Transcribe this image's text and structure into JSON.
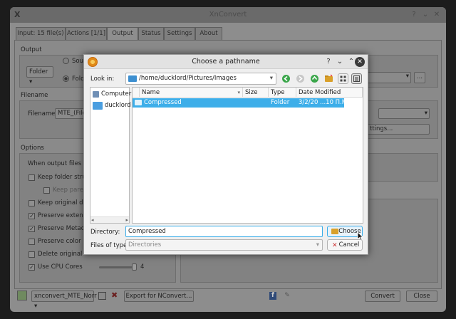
{
  "main_window": {
    "title": "XnConvert",
    "tabs": [
      {
        "label": "Input: 15 file(s)"
      },
      {
        "label": "Actions [1/1]"
      },
      {
        "label": "Output"
      },
      {
        "label": "Status"
      },
      {
        "label": "Settings"
      },
      {
        "label": "About"
      }
    ],
    "output": {
      "section": "Output",
      "dest_combo": "Folder",
      "radio_1": "Sour",
      "radio_2": "Fold",
      "browse": "..."
    },
    "filename": {
      "section": "Filename",
      "label": "Filename",
      "value": "MTE_(Filen",
      "settings_btn": "ttings..."
    },
    "options": {
      "section": "Options",
      "when_label": "When output files alre",
      "items": [
        {
          "label": "Keep folder structu",
          "checked": false
        },
        {
          "label": "Keep parent",
          "checked": false
        },
        {
          "label": "Keep original date",
          "checked": false
        },
        {
          "label": "Preserve extension",
          "checked": true
        },
        {
          "label": "Preserve Metadata",
          "checked": true
        },
        {
          "label": "Preserve color pro",
          "checked": false
        },
        {
          "label": "Delete original",
          "checked": false
        },
        {
          "label": "Use CPU Cores",
          "checked": true
        }
      ],
      "cpu_cores": "4"
    },
    "bottom": {
      "preset": "xnconvert_MTE_Norr",
      "export": "Export for NConvert...",
      "convert": "Convert",
      "close": "Close"
    }
  },
  "dialog": {
    "title": "Choose a pathname",
    "look_in_label": "Look in:",
    "look_in_path": "/home/ducklord/Pictures/Images",
    "sidebar": [
      {
        "label": "Computer"
      },
      {
        "label": "ducklord"
      }
    ],
    "columns": {
      "name": "Name",
      "size": "Size",
      "type": "Type",
      "date": "Date Modified"
    },
    "rows": [
      {
        "name": "Compressed",
        "size": "",
        "type": "Folder",
        "date": "3/2/20 ...10 Π.Μ."
      }
    ],
    "directory_label": "Directory:",
    "directory_value": "Compressed",
    "files_of_type_label": "Files of type:",
    "files_of_type_value": "Directories",
    "choose_label": "Choose",
    "cancel_label": "Cancel"
  }
}
